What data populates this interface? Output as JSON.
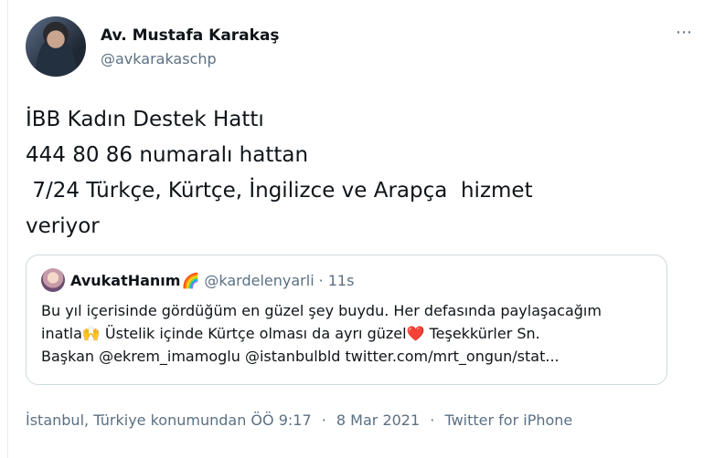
{
  "author": {
    "name": "Av. Mustafa Karakaş",
    "handle": "@avkarakaschp"
  },
  "more_icon": "⋯",
  "tweet": {
    "text": "İBB Kadın Destek Hattı\n444 80 86 numaralı hattan\n 7/24 Türkçe, Kürtçe, İngilizce ve Arapça  hizmet\nveriyor"
  },
  "quoted_tweet": {
    "name": "AvukatHanım",
    "name_emoji": "🌈",
    "handle": "@kardelenyarli",
    "separator": "·",
    "time": "11s",
    "line1": "Bu yıl içerisinde gördüğüm en güzel şey buydu. Her defasında paylaşacağım",
    "line2_a": "inatla",
    "line2_emoji1": "🙌",
    "line2_b": " Üstelik içinde Kürtçe olması da ayrı güzel",
    "line2_emoji2": "❤️",
    "line2_c": " Teşekkürler Sn.",
    "line3": "Başkan @ekrem_imamoglu @istanbulbld twitter.com/mrt_ongun/stat..."
  },
  "footer": {
    "location": "İstanbul, Türkiye konumundan",
    "time": "ÖÖ 9:17",
    "date": "8 Mar 2021",
    "source": "Twitter for iPhone",
    "separator": "·"
  }
}
